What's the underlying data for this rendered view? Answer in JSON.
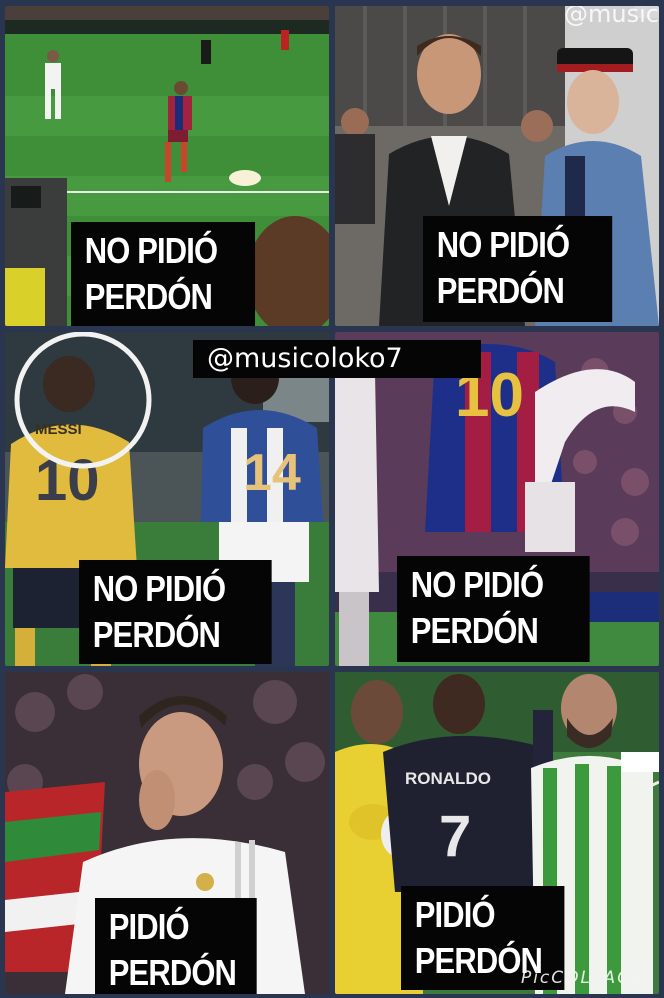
{
  "handle": "@musicoloko7",
  "corner_handle": "@music",
  "watermark": "PicCOLLAGE",
  "panels": [
    {
      "line1": "NO PIDIÓ",
      "line2": "PERDÓN"
    },
    {
      "line1": "NO PIDIÓ",
      "line2": "PERDÓN"
    },
    {
      "line1": "NO PIDIÓ",
      "line2": "PERDÓN"
    },
    {
      "line1": "NO PIDIÓ",
      "line2": "PERDÓN"
    },
    {
      "line1": "PIDIÓ",
      "line2": "PERDÓN"
    },
    {
      "line1": "PIDIÓ",
      "line2": "PERDÓN"
    }
  ],
  "jersey_text": {
    "messi_name": "MESSI",
    "messi_number": "10",
    "opponent_number": "14",
    "barca_number": "10",
    "ronaldo_name": "RONALDO",
    "ronaldo_number": "7"
  }
}
